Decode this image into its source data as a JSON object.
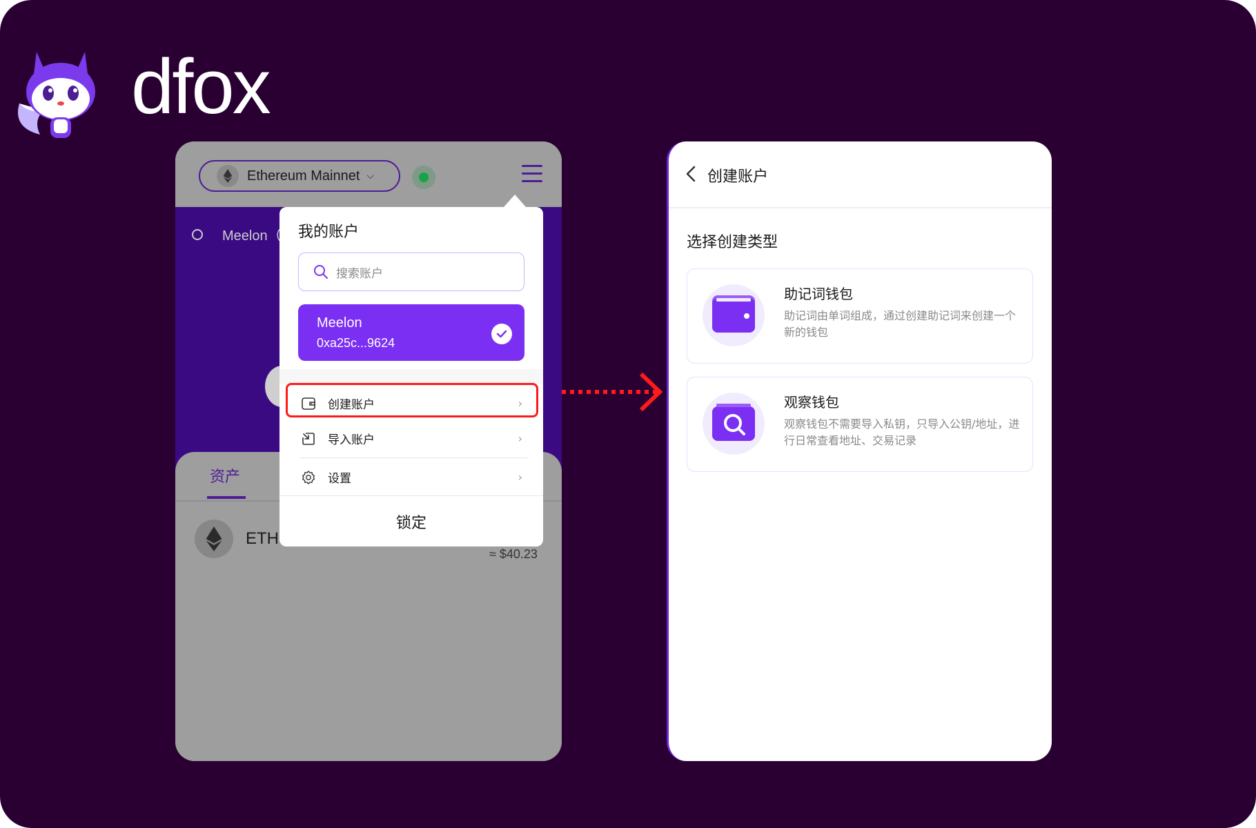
{
  "brand": {
    "name": "dfox"
  },
  "left_screen": {
    "network": {
      "label": "Ethereum Mainnet",
      "status_color": "#16a34a"
    },
    "background_account": {
      "name_partial": "Meelon（"
    },
    "tabs": {
      "assets": "资产"
    },
    "token": {
      "symbol": "ETH",
      "fiat_value": "≈ $40.23"
    },
    "dropdown": {
      "title": "我的账户",
      "search_placeholder": "搜索账户",
      "selected_account": {
        "name": "Meelon",
        "address": "0xa25c...9624"
      },
      "menu": [
        {
          "label": "创建账户",
          "icon": "wallet-icon",
          "highlighted": true
        },
        {
          "label": "导入账户",
          "icon": "import-icon"
        },
        {
          "label": "设置",
          "icon": "gear-icon"
        }
      ],
      "lock_label": "锁定"
    }
  },
  "right_screen": {
    "title": "创建账户",
    "subtitle": "选择创建类型",
    "types": [
      {
        "title": "助记词钱包",
        "desc": "助记词由单词组成，通过创建助记词来创建一个新的钱包",
        "icon": "wallet-icon"
      },
      {
        "title": "观察钱包",
        "desc": "观察钱包不需要导入私钥，只导入公钥/地址，进行日常查看地址、交易记录",
        "icon": "search-wallet-icon"
      }
    ]
  },
  "colors": {
    "brand_purple": "#7b2ff2",
    "highlight_red": "#ff1a1a",
    "background": "#2a0033"
  }
}
